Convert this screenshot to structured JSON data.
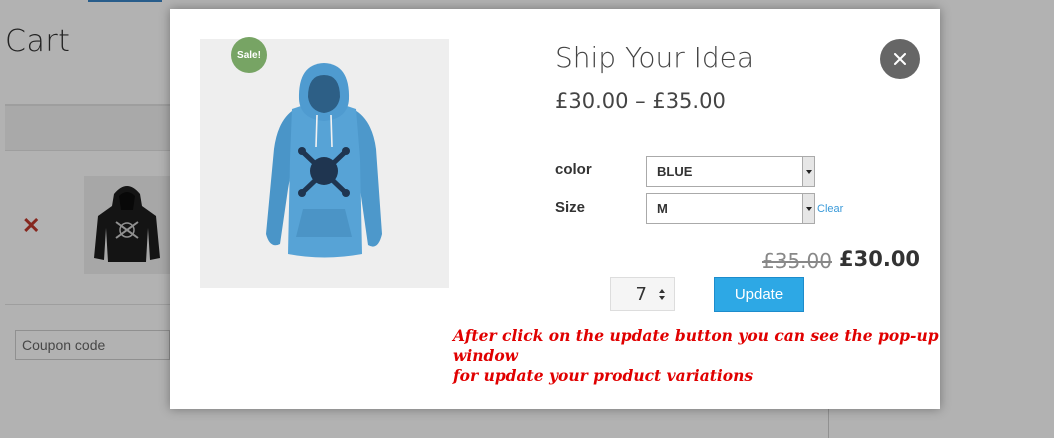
{
  "background": {
    "page_title": "Cart",
    "coupon_placeholder": "Coupon code",
    "remove_glyph": "✕",
    "remove_color": "#c0392b"
  },
  "modal": {
    "sale_badge": "Sale!",
    "product_title": "Ship Your Idea",
    "price_range": "£30.00 – £35.00",
    "variations": [
      {
        "label": "color",
        "selected": "BLUE"
      },
      {
        "label": "Size",
        "selected": "M"
      }
    ],
    "clear_label": "Clear",
    "old_price": "£35.00",
    "new_price": "£30.00",
    "quantity": "7",
    "update_label": "Update",
    "close_icon": "close-icon",
    "accent_color": "#2da8e5",
    "sale_color": "#77a464"
  },
  "annotation": {
    "line1": "After click on the update button you can see the pop-up window",
    "line2": "for update your product variations",
    "color": "#e00000"
  }
}
